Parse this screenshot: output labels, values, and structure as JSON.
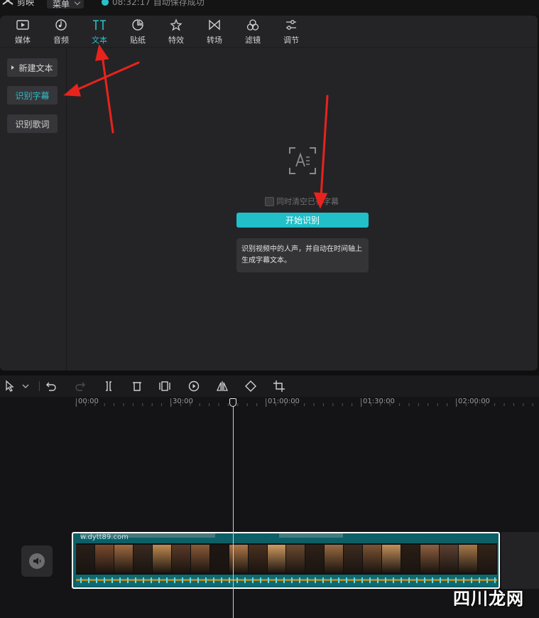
{
  "titlebar": {
    "app_title": "剪映",
    "menu_label": "菜单",
    "save_status": "08:32:17 自动保存成功"
  },
  "toolbar": {
    "items": [
      {
        "label": "媒体",
        "icon": "media-icon"
      },
      {
        "label": "音频",
        "icon": "audio-icon"
      },
      {
        "label": "文本",
        "icon": "text-icon",
        "active": true
      },
      {
        "label": "贴纸",
        "icon": "sticker-icon"
      },
      {
        "label": "特效",
        "icon": "effects-icon"
      },
      {
        "label": "转场",
        "icon": "transition-icon"
      },
      {
        "label": "滤镜",
        "icon": "filter-icon"
      },
      {
        "label": "调节",
        "icon": "adjust-icon"
      }
    ]
  },
  "sidebar": {
    "items": [
      {
        "label": "新建文本"
      },
      {
        "label": "识别字幕",
        "active": true
      },
      {
        "label": "识别歌词"
      }
    ]
  },
  "content": {
    "checkbox_label": "同时清空已有字幕",
    "start_button": "开始识别",
    "description": "识别视频中的人声，并自动在时间轴上生成字幕文本。"
  },
  "timeline": {
    "ruler": [
      "00:00",
      "30:00",
      "01:00:00",
      "01:30:00",
      "02:00:00"
    ],
    "clip_label": "w.dytt89.com"
  },
  "watermark": "四川龙网",
  "colors": {
    "accent": "#21bfc8",
    "arrow": "#e8231d",
    "panel": "#242426"
  }
}
